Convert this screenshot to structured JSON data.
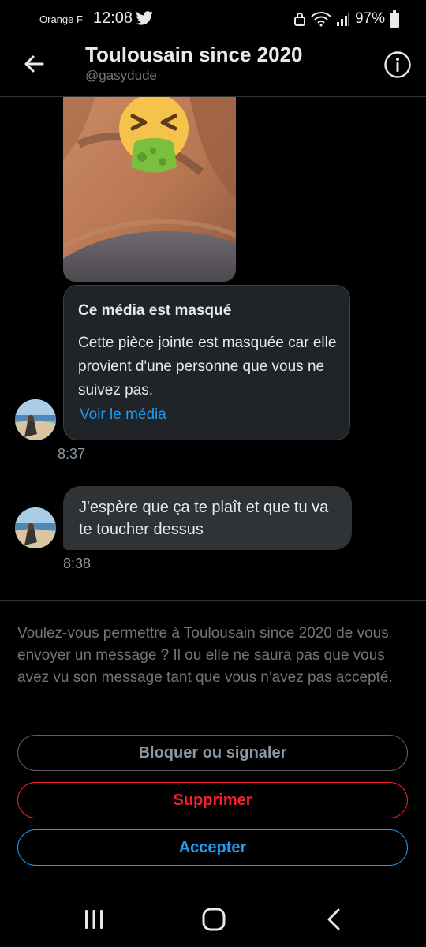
{
  "status_bar": {
    "carrier": "Orange F",
    "time": "12:08",
    "battery": "97%"
  },
  "header": {
    "title": "Toulousain since 2020",
    "handle": "@gasydude"
  },
  "conversation": {
    "masked_media": {
      "title": "Ce média est masqué",
      "body": "Cette pièce jointe est masquée car elle provient d'une personne que vous ne suivez pas.",
      "link": "Voir le média"
    },
    "timestamp_1": "8:37",
    "message": "J'espère que ça te plaît et que tu va te toucher dessus",
    "timestamp_2": "8:38"
  },
  "request": {
    "text": "Voulez-vous permettre à Toulousain since 2020 de vous envoyer un message ? Il ou elle ne saura pas que vous avez vu son message tant que vous n'avez pas accepté.",
    "block_label": "Bloquer ou signaler",
    "delete_label": "Supprimer",
    "accept_label": "Accepter"
  },
  "colors": {
    "accent": "#1d9bf0",
    "danger": "#f4212e",
    "background": "#000000",
    "bubble": "#2f3336"
  },
  "icons": {
    "back": "arrow-left-icon",
    "info": "info-icon",
    "status_twitter": "twitter-bird-icon",
    "emoji": "vomiting-face-emoji"
  }
}
